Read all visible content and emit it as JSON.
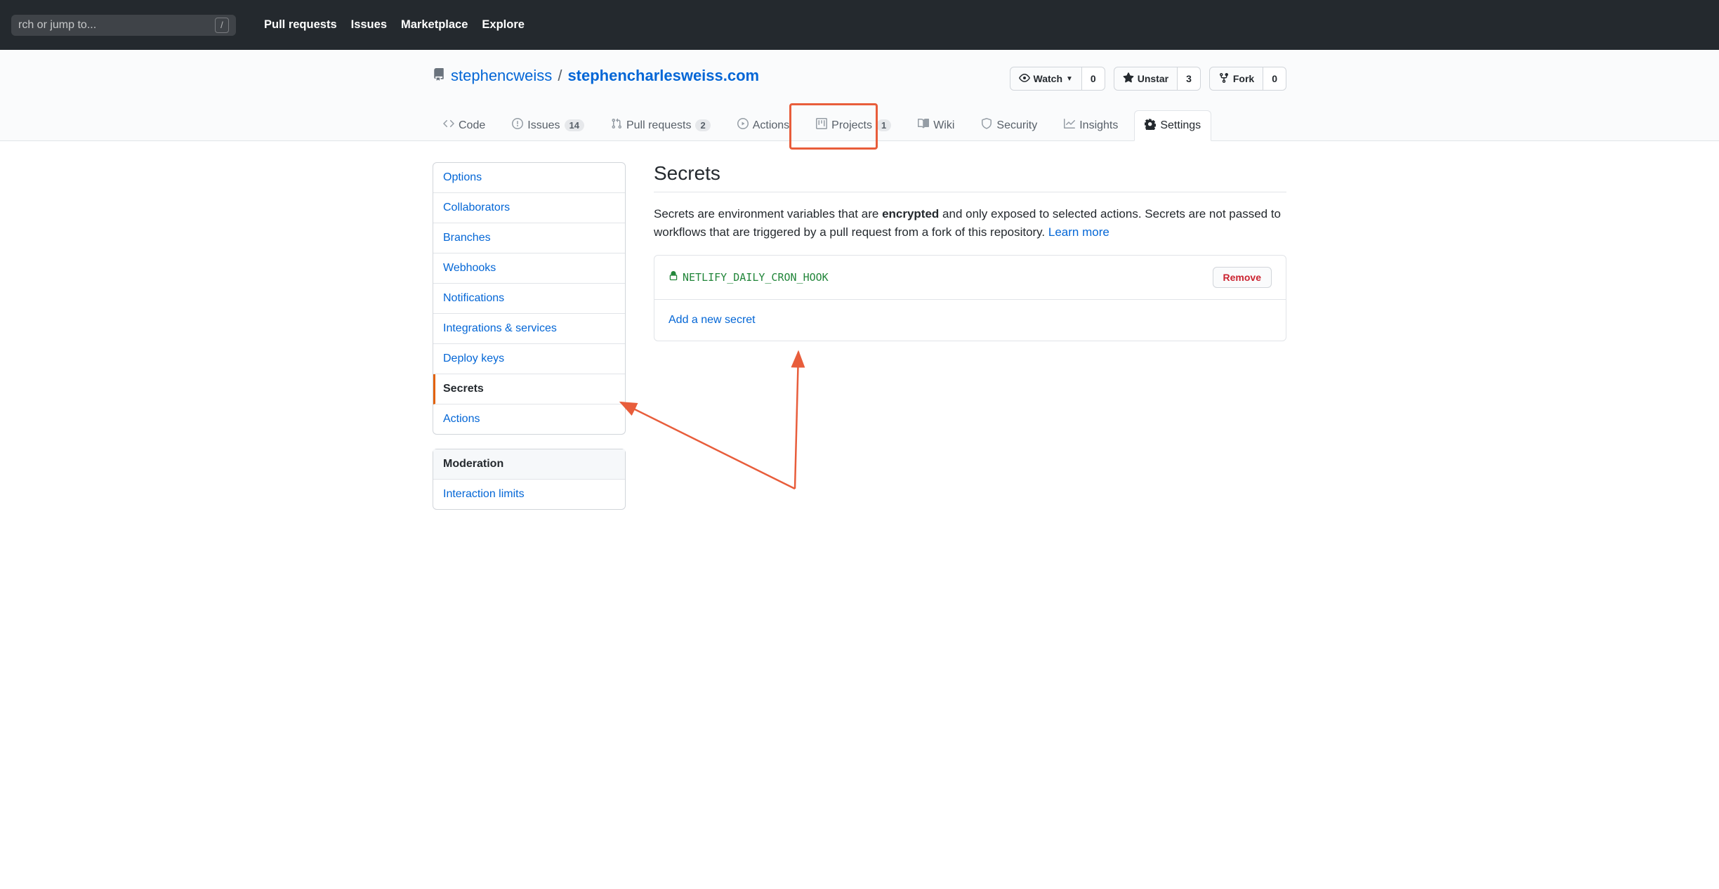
{
  "header": {
    "search_placeholder": "rch or jump to...",
    "slash": "/",
    "nav": [
      "Pull requests",
      "Issues",
      "Marketplace",
      "Explore"
    ]
  },
  "repo": {
    "owner": "stephencweiss",
    "name": "stephencharlesweiss.com",
    "watch_label": "Watch",
    "watch_count": "0",
    "unstar_label": "Unstar",
    "star_count": "3",
    "fork_label": "Fork",
    "fork_count": "0"
  },
  "repo_nav": {
    "code": "Code",
    "issues": "Issues",
    "issues_count": "14",
    "pulls": "Pull requests",
    "pulls_count": "2",
    "actions": "Actions",
    "projects": "Projects",
    "projects_count": "1",
    "wiki": "Wiki",
    "security": "Security",
    "insights": "Insights",
    "settings": "Settings"
  },
  "sidebar": {
    "items": [
      {
        "label": "Options"
      },
      {
        "label": "Collaborators"
      },
      {
        "label": "Branches"
      },
      {
        "label": "Webhooks"
      },
      {
        "label": "Notifications"
      },
      {
        "label": "Integrations & services"
      },
      {
        "label": "Deploy keys"
      },
      {
        "label": "Secrets"
      },
      {
        "label": "Actions"
      }
    ],
    "moderation_header": "Moderation",
    "moderation_items": [
      {
        "label": "Interaction limits"
      }
    ]
  },
  "secrets": {
    "title": "Secrets",
    "desc_pre": "Secrets are environment variables that are ",
    "desc_bold": "encrypted",
    "desc_post": " and only exposed to selected actions. Secrets are not passed to workflows that are triggered by a pull request from a fork of this repository. ",
    "learn_more": "Learn more",
    "secret_name": "NETLIFY_DAILY_CRON_HOOK",
    "remove_label": "Remove",
    "add_label": "Add a new secret"
  }
}
